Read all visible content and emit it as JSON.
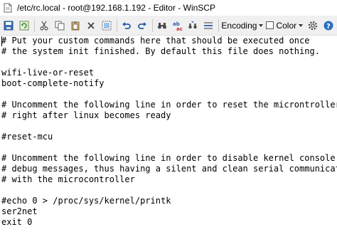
{
  "window": {
    "title": "/etc/rc.local - root@192.168.1.192 - Editor - WinSCP"
  },
  "toolbar": {
    "encoding_label": "Encoding",
    "color_label": "Color",
    "buttons": [
      {
        "name": "save-icon"
      },
      {
        "name": "reload-icon"
      },
      {
        "name": "cut-icon"
      },
      {
        "name": "copy-icon"
      },
      {
        "name": "paste-icon"
      },
      {
        "name": "delete-icon"
      },
      {
        "name": "select-all-icon"
      },
      {
        "name": "undo-icon"
      },
      {
        "name": "redo-icon"
      },
      {
        "name": "find-icon"
      },
      {
        "name": "replace-icon"
      },
      {
        "name": "find-next-icon"
      },
      {
        "name": "go-to-line-icon"
      },
      {
        "name": "preferences-icon"
      },
      {
        "name": "help-icon"
      }
    ]
  },
  "editor": {
    "lines": [
      "# Put your custom commands here that should be executed once",
      "# the system init finished. By default this file does nothing.",
      "",
      "wifi-live-or-reset",
      "boot-complete-notify",
      "",
      "# Uncomment the following line in order to reset the microntroller",
      "# right after linux becomes ready",
      "",
      "#reset-mcu",
      "",
      "# Uncomment the following line in order to disable kernel console",
      "# debug messages, thus having a silent and clean serial communication",
      "# with the microcontroller",
      "",
      "#echo 0 > /proc/sys/kernel/printk",
      "ser2net",
      "exit 0"
    ]
  }
}
